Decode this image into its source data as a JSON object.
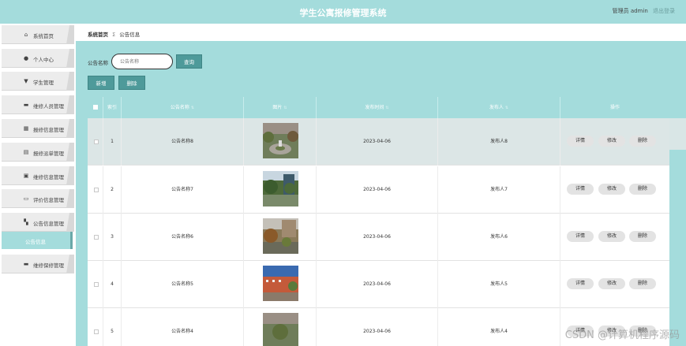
{
  "header": {
    "title": "学生公寓报修管理系统",
    "user_label": "管理员 admin",
    "logout_label": "退出登录"
  },
  "sidebar": {
    "items": [
      {
        "label": "系统首页",
        "icon": "home-icon",
        "glyph": "⌂"
      },
      {
        "label": "个人中心",
        "icon": "person-icon",
        "glyph": "●"
      },
      {
        "label": "学生管理",
        "icon": "student-icon",
        "glyph": "▼"
      },
      {
        "label": "维修人员管理",
        "icon": "briefcase-icon",
        "glyph": "▬"
      },
      {
        "label": "报修信息管理",
        "icon": "grid-icon",
        "glyph": "▦"
      },
      {
        "label": "报修派单管理",
        "icon": "document-icon",
        "glyph": "▤"
      },
      {
        "label": "维修信息管理",
        "icon": "clipboard-icon",
        "glyph": "▣"
      },
      {
        "label": "评价信息管理",
        "icon": "monitor-icon",
        "glyph": "▭"
      },
      {
        "label": "公告信息管理",
        "icon": "apps-icon",
        "glyph": "▚"
      },
      {
        "label": "维修保修管理",
        "icon": "chat-icon",
        "glyph": "▬"
      }
    ],
    "active_sub": "公告信息"
  },
  "breadcrumb": {
    "home": "系统首页",
    "separator": "Σ",
    "current": "公告信息"
  },
  "search": {
    "label": "公告名称",
    "placeholder": "公告名称",
    "button": "查询"
  },
  "actions": {
    "add": "新增",
    "delete": "删除"
  },
  "table": {
    "columns": [
      "索引",
      "公告名称",
      "图片",
      "发布时间",
      "发布人",
      "操作"
    ],
    "rows": [
      {
        "index": "1",
        "name": "公告名称8",
        "time": "2023-04-06",
        "publisher": "发布人8"
      },
      {
        "index": "2",
        "name": "公告名称7",
        "time": "2023-04-06",
        "publisher": "发布人7"
      },
      {
        "index": "3",
        "name": "公告名称6",
        "time": "2023-04-06",
        "publisher": "发布人6"
      },
      {
        "index": "4",
        "name": "公告名称5",
        "time": "2023-04-06",
        "publisher": "发布人5"
      },
      {
        "index": "5",
        "name": "公告名称4",
        "time": "2023-04-06",
        "publisher": "发布人4"
      }
    ],
    "row_actions": [
      "详情",
      "修改",
      "删除"
    ]
  },
  "watermark": "CSDN @计算机程序源码",
  "colors": {
    "accent": "#a4dcdc",
    "button": "#4e9a9a"
  }
}
